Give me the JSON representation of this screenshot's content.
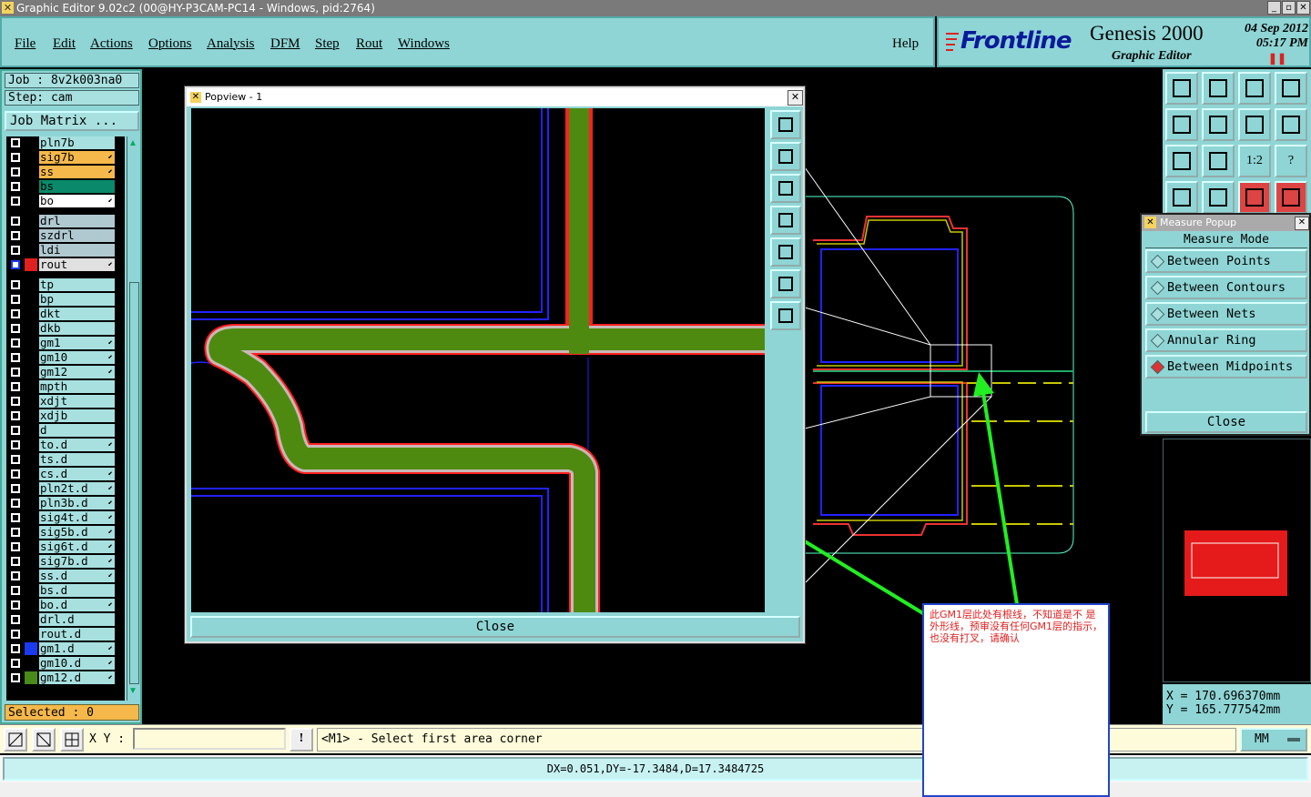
{
  "window": {
    "title": "Graphic Editor 9.02c2 (00@HY-P3CAM-PC14 - Windows, pid:2764)"
  },
  "menu": {
    "items": [
      "File",
      "Edit",
      "Actions",
      "Options",
      "Analysis",
      "DFM",
      "Step",
      "Rout",
      "Windows"
    ],
    "help": "Help"
  },
  "brand": {
    "logo": "Frontline",
    "product": "Genesis 2000",
    "subtitle": "Graphic Editor",
    "date": "04 Sep 2012",
    "time": "05:17 PM"
  },
  "job": {
    "job_label": "Job : 8v2k003na0",
    "step_label": "Step: cam",
    "matrix_button": "Job Matrix ...",
    "selected": "Selected : 0"
  },
  "layers": [
    {
      "name": "pln7b",
      "bg": "#a8e0e0",
      "color": "#000",
      "mark": ""
    },
    {
      "name": "sig7b",
      "bg": "#f5b84a",
      "color": "#000",
      "mark": "e"
    },
    {
      "name": "ss",
      "bg": "#f5b84a",
      "color": "#000",
      "mark": "e"
    },
    {
      "name": "bs",
      "bg": "#0a8a6a",
      "color": "#000",
      "mark": ""
    },
    {
      "name": "bo",
      "bg": "#ffffff",
      "color": "#000",
      "mark": "e"
    },
    {
      "name": "drl",
      "bg": "#b0c8d0",
      "color": "#000",
      "mark": ""
    },
    {
      "name": "szdrl",
      "bg": "#b0c8d0",
      "color": "#000",
      "mark": ""
    },
    {
      "name": "ldi",
      "bg": "#b0c8d0",
      "color": "#000",
      "mark": ""
    },
    {
      "name": "rout",
      "bg": "#e0e0e0",
      "color": "#e02020",
      "mark": "e",
      "active": true
    },
    {
      "name": "tp",
      "bg": "#a8e0e0",
      "color": "#000",
      "mark": ""
    },
    {
      "name": "bp",
      "bg": "#a8e0e0",
      "color": "#000",
      "mark": ""
    },
    {
      "name": "dkt",
      "bg": "#a8e0e0",
      "color": "#000",
      "mark": ""
    },
    {
      "name": "dkb",
      "bg": "#a8e0e0",
      "color": "#000",
      "mark": ""
    },
    {
      "name": "gm1",
      "bg": "#a8e0e0",
      "color": "#000",
      "mark": "e"
    },
    {
      "name": "gm10",
      "bg": "#a8e0e0",
      "color": "#000",
      "mark": "e"
    },
    {
      "name": "gm12",
      "bg": "#a8e0e0",
      "color": "#000",
      "mark": "e"
    },
    {
      "name": "mpth",
      "bg": "#a8e0e0",
      "color": "#000",
      "mark": ""
    },
    {
      "name": "xdjt",
      "bg": "#a8e0e0",
      "color": "#000",
      "mark": ""
    },
    {
      "name": "xdjb",
      "bg": "#a8e0e0",
      "color": "#000",
      "mark": ""
    },
    {
      "name": "d",
      "bg": "#a8e0e0",
      "color": "#000",
      "mark": ""
    },
    {
      "name": "to.d",
      "bg": "#a8e0e0",
      "color": "#000",
      "mark": "e"
    },
    {
      "name": "ts.d",
      "bg": "#a8e0e0",
      "color": "#000",
      "mark": ""
    },
    {
      "name": "cs.d",
      "bg": "#a8e0e0",
      "color": "#000",
      "mark": "e"
    },
    {
      "name": "pln2t.d",
      "bg": "#a8e0e0",
      "color": "#000",
      "mark": "e"
    },
    {
      "name": "pln3b.d",
      "bg": "#a8e0e0",
      "color": "#000",
      "mark": "e"
    },
    {
      "name": "sig4t.d",
      "bg": "#a8e0e0",
      "color": "#000",
      "mark": "e"
    },
    {
      "name": "sig5b.d",
      "bg": "#a8e0e0",
      "color": "#000",
      "mark": "e"
    },
    {
      "name": "sig6t.d",
      "bg": "#a8e0e0",
      "color": "#000",
      "mark": "e"
    },
    {
      "name": "sig7b.d",
      "bg": "#a8e0e0",
      "color": "#000",
      "mark": "e"
    },
    {
      "name": "ss.d",
      "bg": "#a8e0e0",
      "color": "#000",
      "mark": "e"
    },
    {
      "name": "bs.d",
      "bg": "#a8e0e0",
      "color": "#000",
      "mark": ""
    },
    {
      "name": "bo.d",
      "bg": "#a8e0e0",
      "color": "#000",
      "mark": "e"
    },
    {
      "name": "drl.d",
      "bg": "#a8e0e0",
      "color": "#000",
      "mark": ""
    },
    {
      "name": "rout.d",
      "bg": "#a8e0e0",
      "color": "#000",
      "mark": ""
    },
    {
      "name": "gm1.d",
      "bg": "#a8e0e0",
      "color": "#1a3aee",
      "mark": "e"
    },
    {
      "name": "gm10.d",
      "bg": "#a8e0e0",
      "color": "#000",
      "mark": "e"
    },
    {
      "name": "gm12.d",
      "bg": "#a8e0e0",
      "color": "#4a8a1a",
      "mark": "e"
    }
  ],
  "popview": {
    "title": "Popview - 1",
    "close": "Close"
  },
  "measure": {
    "title": "Measure Popup",
    "header": "Measure Mode",
    "options": [
      "Between Points",
      "Between Contours",
      "Between Nets",
      "Annular Ring",
      "Between Midpoints"
    ],
    "selected": "Between Midpoints",
    "close": "Close"
  },
  "toolbox": {
    "ratio_label": "1:2",
    "help_label": "?"
  },
  "coords": {
    "x": "X  =  170.696370mm",
    "y": "Y  =  165.777542mm"
  },
  "command": {
    "xy_label": "X Y :",
    "xy_value": "",
    "prompt": "<M1> - Select first area corner",
    "units": "MM"
  },
  "status": {
    "text": "DX=0.051,DY=-17.3484,D=17.3484725"
  },
  "note": {
    "text": "此GM1层此处有根线，不知道是不 是外形线，预审没有任何GM1层的指示，也没有打叉，请确认"
  },
  "colors": {
    "panel": "#8fd5d5",
    "trace_green": "#4f8a10",
    "trace_red": "#ff2020",
    "outline_blue": "#2020ff",
    "annotation_arrow": "#22ee22"
  }
}
